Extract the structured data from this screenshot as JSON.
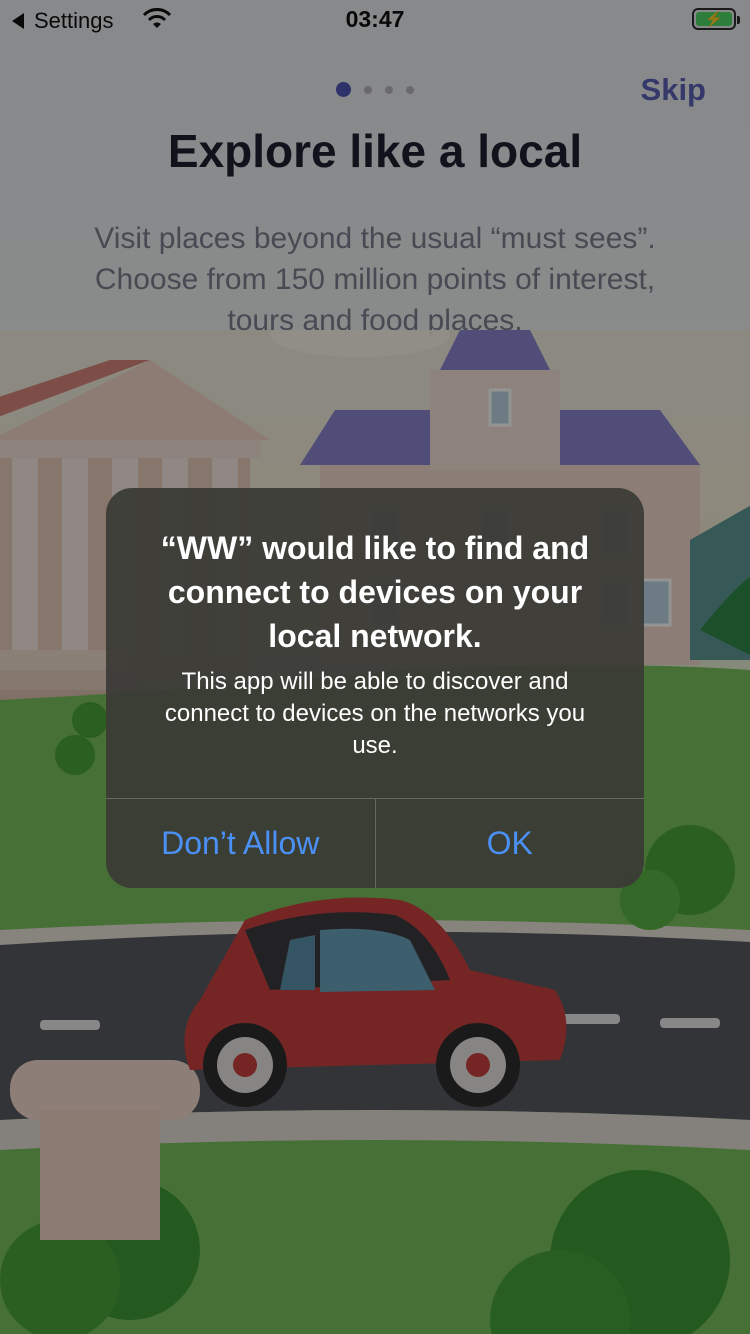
{
  "status_bar": {
    "back_label": "Settings",
    "time": "03:47"
  },
  "onboarding": {
    "skip_label": "Skip",
    "headline": "Explore like a local",
    "subtext": "Visit places beyond the usual “must sees”. Choose from 150 million points of interest, tours and food places.",
    "page_count": 4,
    "active_page": 1
  },
  "alert": {
    "title": "“WW” would like to find and connect to devices on your local network.",
    "message": "This app will be able to discover and connect to devices on the networks you use.",
    "deny_label": "Don’t Allow",
    "ok_label": "OK"
  },
  "colors": {
    "accent": "#5c62b7",
    "alert_button": "#4a90f5",
    "battery": "#4cd964"
  },
  "icons": [
    "back-chevron-icon",
    "wifi-icon",
    "battery-charging-icon"
  ]
}
